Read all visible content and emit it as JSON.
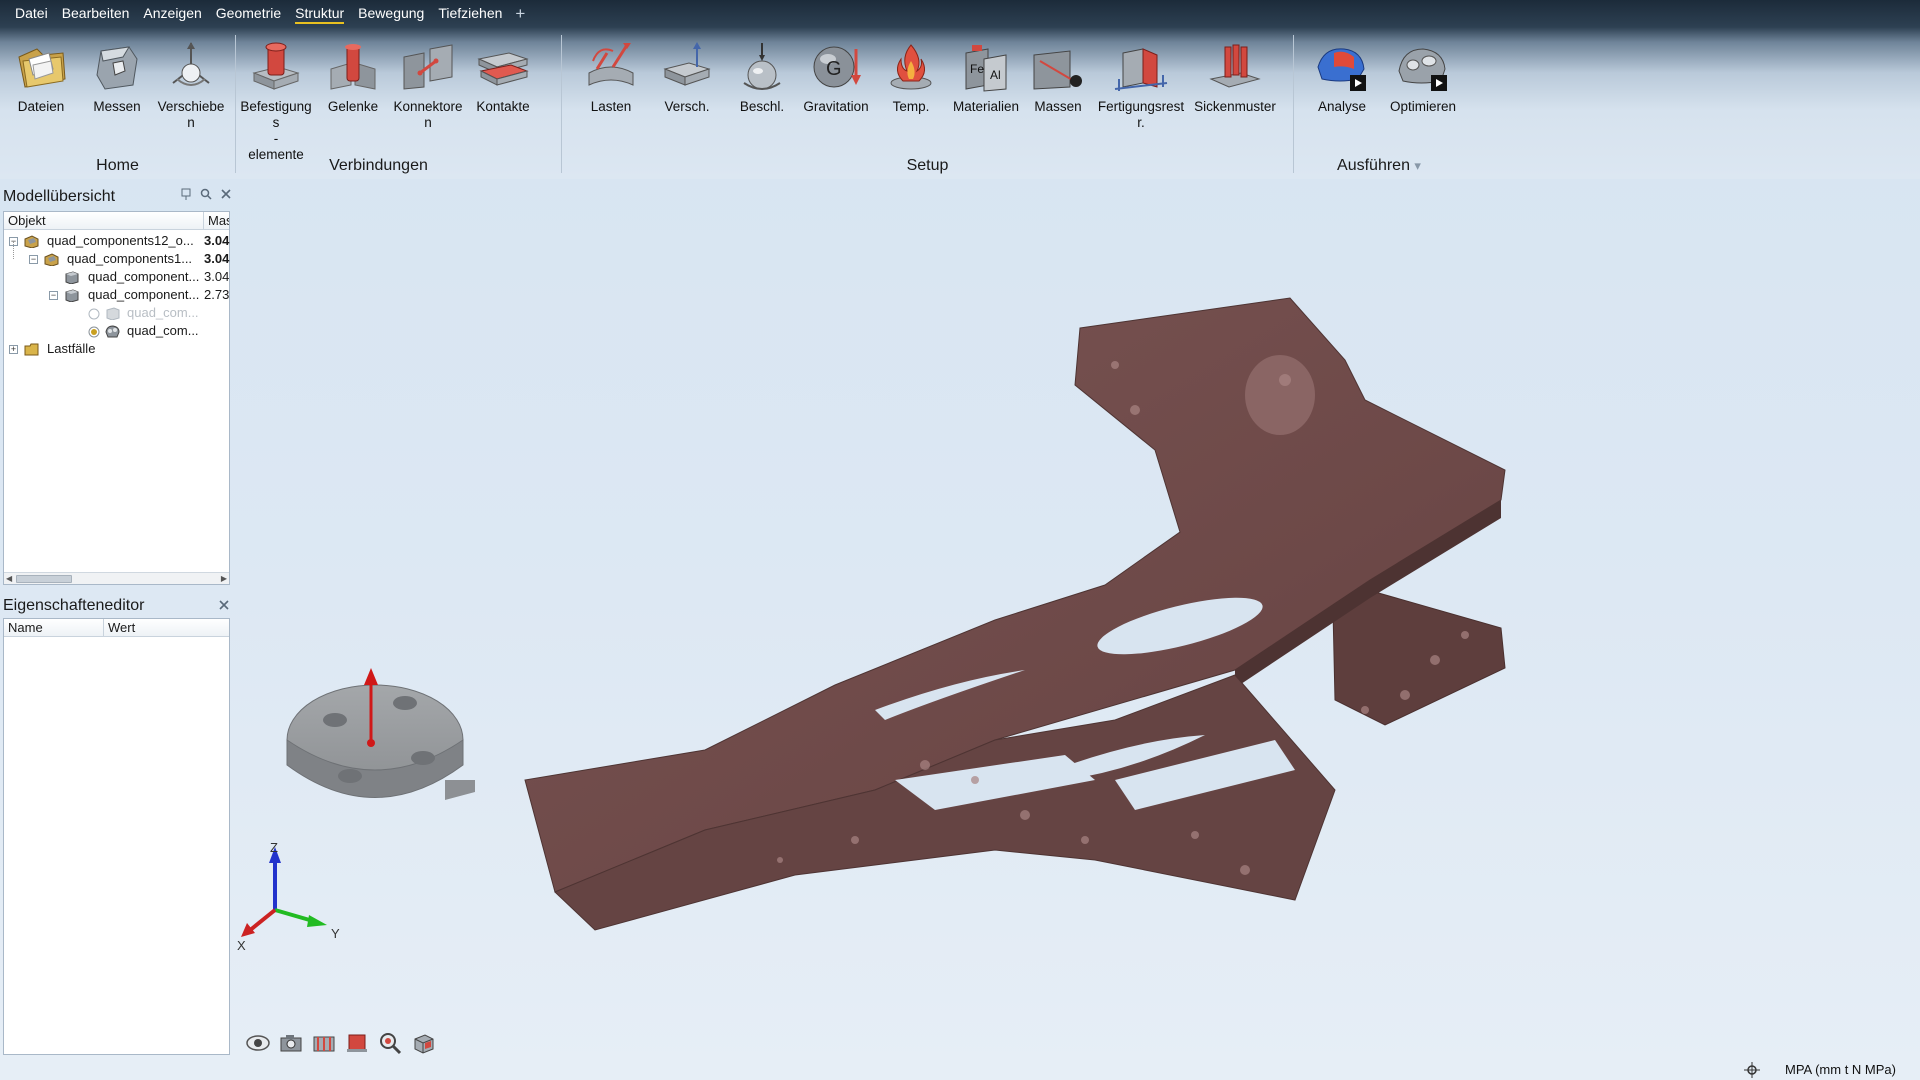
{
  "menu": {
    "items": [
      {
        "label": "Datei",
        "active": false
      },
      {
        "label": "Bearbeiten",
        "active": false
      },
      {
        "label": "Anzeigen",
        "active": false
      },
      {
        "label": "Geometrie",
        "active": false
      },
      {
        "label": "Struktur",
        "active": true
      },
      {
        "label": "Bewegung",
        "active": false
      },
      {
        "label": "Tiefziehen",
        "active": false
      }
    ],
    "add_symbol": "+"
  },
  "ribbon": {
    "groups": {
      "home": "Home",
      "verbindungen": "Verbindungen",
      "setup": "Setup",
      "ausfuehren": "Ausführen"
    },
    "ausfuehren_arrow": "▾",
    "tools": {
      "dateien": "Dateien",
      "messen": "Messen",
      "verschieben": "Verschiebe\nn",
      "befestigungselemente": "Befestigungs\n-\nelemente",
      "gelenke": "Gelenke",
      "konnektoren": "Konnektore\nn",
      "kontakte": "Kontakte",
      "lasten": "Lasten",
      "versch": "Versch.",
      "beschl": "Beschl.",
      "gravitation": "Gravitation",
      "temp": "Temp.",
      "materialien": "Materialien",
      "massen": "Massen",
      "fertigungsrestr": "Fertigungsrestr.",
      "sickenmuster": "Sickenmuster",
      "analyse": "Analyse",
      "optimieren": "Optimieren"
    }
  },
  "model_overview": {
    "title": "Modellübersicht",
    "columns": {
      "object": "Objekt",
      "mass": "Mas"
    },
    "rows": [
      {
        "label": "quad_components12_o...",
        "value": "3.04",
        "bold": true
      },
      {
        "label": "quad_components1...",
        "value": "3.04",
        "bold": true
      },
      {
        "label": "quad_component...",
        "value": "3.04",
        "bold": false
      },
      {
        "label": "quad_component...",
        "value": "2.73",
        "bold": false
      },
      {
        "label": "quad_com...",
        "value": "",
        "bold": false
      },
      {
        "label": "quad_com...",
        "value": "",
        "bold": false
      },
      {
        "label": "Lastfälle",
        "value": "",
        "bold": false
      }
    ]
  },
  "property_editor": {
    "title": "Eigenschafteneditor",
    "columns": {
      "name": "Name",
      "value": "Wert"
    }
  },
  "viewport": {
    "axis_labels": {
      "z": "Z",
      "y": "Y",
      "x": "X"
    },
    "part_color": "#6e4a49",
    "background_top": "#d6e4f2"
  },
  "status": {
    "units": "MPA (mm t N MPa)"
  },
  "icons": {
    "bottom_tools": [
      "view-eye-icon",
      "camera-icon",
      "section-cut-icon",
      "display-mode-icon",
      "zoom-icon",
      "view-cube-icon"
    ]
  }
}
